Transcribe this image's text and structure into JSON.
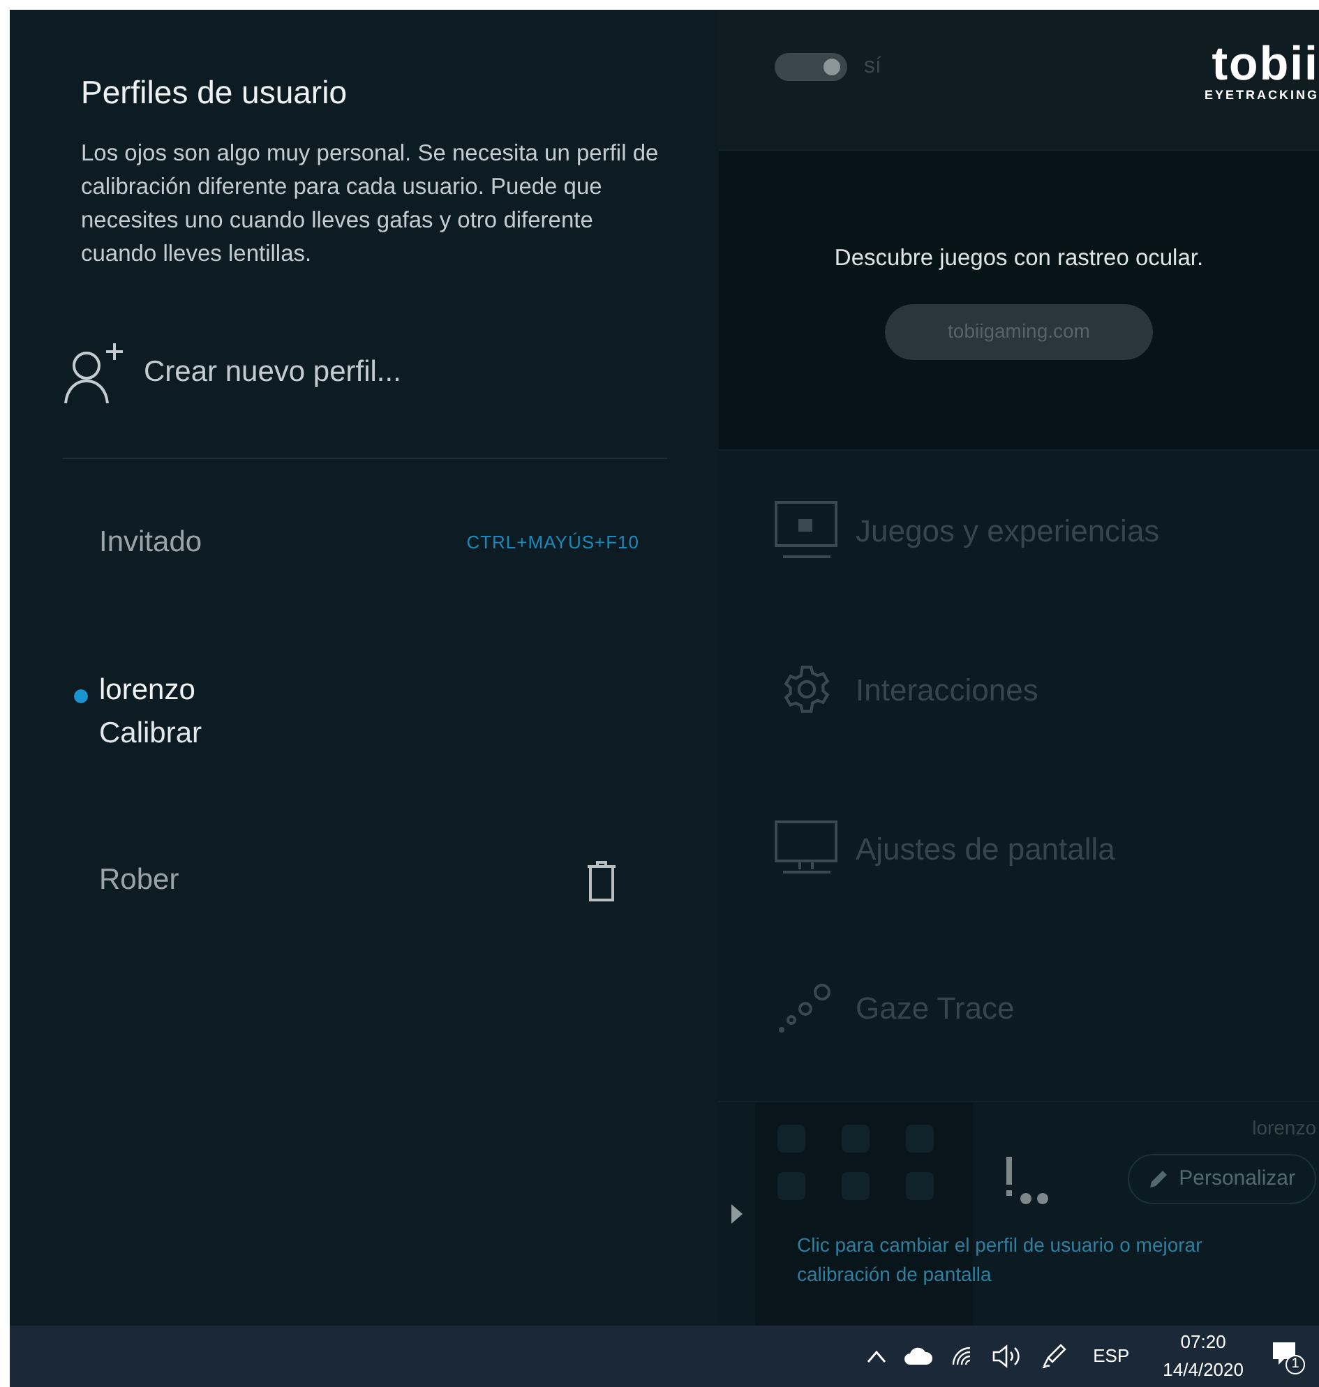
{
  "profiles_panel": {
    "title": "Perfiles de usuario",
    "description": "Los ojos son algo muy personal. Se necesita un perfil de calibración diferente para cada usuario. Puede que necesites uno cuando lleves gafas y otro diferente cuando lleves lentillas.",
    "create_label": "Crear nuevo perfil...",
    "profiles": [
      {
        "name": "Invitado",
        "shortcut": "CTRL+MAYÚS+F10",
        "active": false,
        "deletable": false
      },
      {
        "name": "lorenzo",
        "action": "Calibrar",
        "active": true,
        "deletable": false
      },
      {
        "name": "Rober",
        "active": false,
        "deletable": true
      }
    ]
  },
  "main": {
    "toggle": {
      "on": true,
      "label": "sí"
    },
    "logo": {
      "name": "tobii",
      "tagline": "EYETRACKING"
    },
    "promo": {
      "text": "Descubre juegos con rastreo ocular.",
      "link": "tobiigaming.com"
    },
    "menu": [
      {
        "label": "Juegos y experiencias",
        "kind": "games"
      },
      {
        "label": "Interacciones",
        "kind": "gear"
      },
      {
        "label": "Ajustes de pantalla",
        "kind": "monitor"
      },
      {
        "label": "Gaze Trace",
        "kind": "trace"
      }
    ],
    "footer": {
      "user": "lorenzo",
      "hint": "Clic para cambiar el perfil de usuario o mejorar calibración de pantalla",
      "button": "Personalizar"
    }
  },
  "taskbar": {
    "language": "ESP",
    "time": "07:20",
    "date": "14/4/2020",
    "notifications": "1"
  }
}
